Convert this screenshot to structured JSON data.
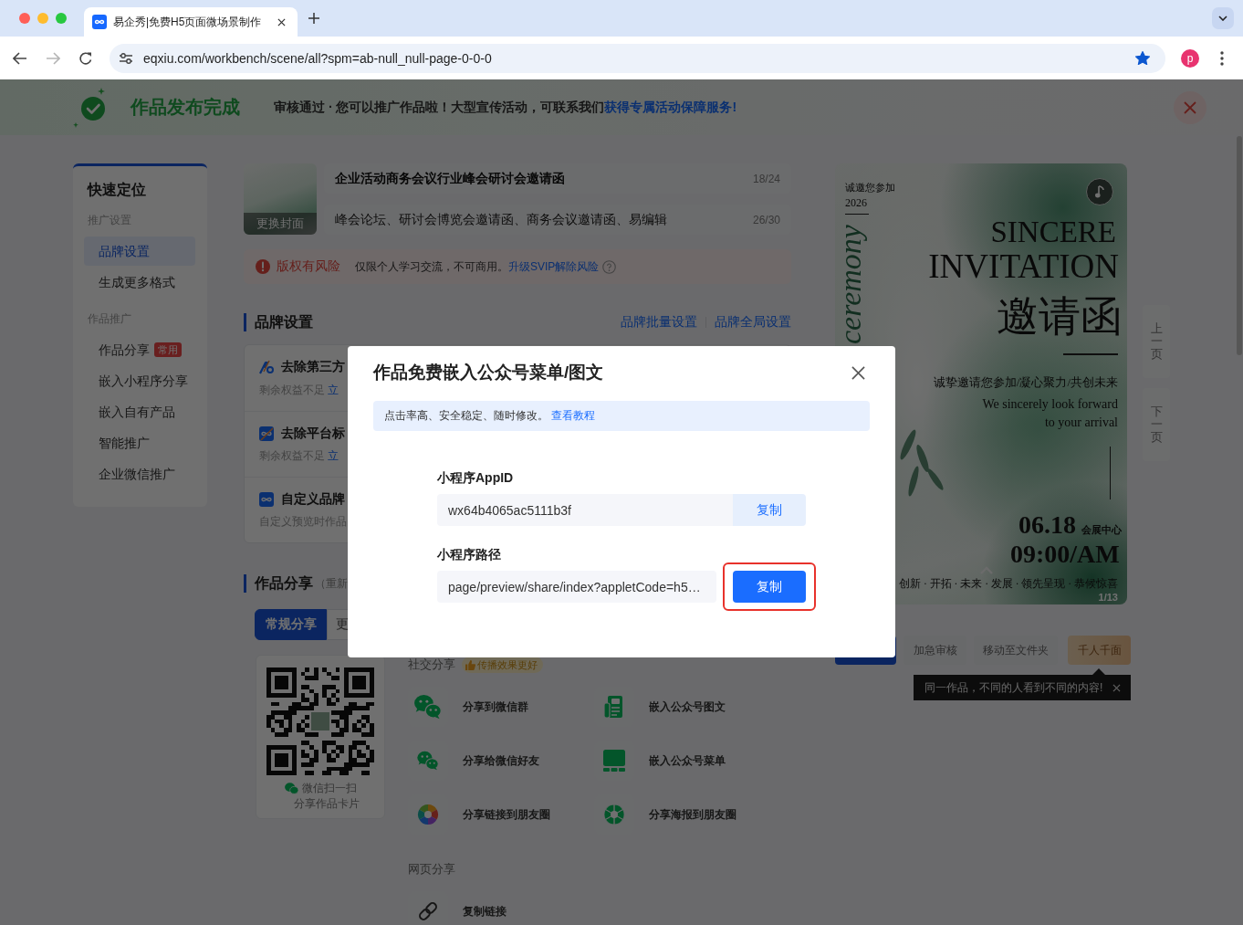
{
  "browser": {
    "tab_title": "易企秀|免费H5页面微场景制作",
    "url": "eqxiu.com/workbench/scene/all?spm=ab-null_null-page-0-0-0",
    "bookmarked": true,
    "profile_initial": "p"
  },
  "banner": {
    "title": "作品发布完成",
    "message": "审核通过 · 您可以推广作品啦！大型宣传活动，可联系我们",
    "link": "获得专属活动保障服务!"
  },
  "sidebar": {
    "title": "快速定位",
    "groups": [
      {
        "label": "推广设置",
        "items": [
          {
            "label": "品牌设置",
            "selected": true
          },
          {
            "label": "生成更多格式",
            "selected": false
          }
        ]
      },
      {
        "label": "作品推广",
        "items": [
          {
            "label": "作品分享",
            "selected": false,
            "badge": "常用"
          },
          {
            "label": "嵌入小程序分享",
            "selected": false
          },
          {
            "label": "嵌入自有产品",
            "selected": false
          },
          {
            "label": "智能推广",
            "selected": false
          },
          {
            "label": "企业微信推广",
            "selected": false
          }
        ]
      }
    ]
  },
  "work": {
    "cover_button": "更换封面",
    "title": {
      "value": "企业活动商务会议行业峰会研讨会邀请函",
      "count": "18/24"
    },
    "description": {
      "value": "峰会论坛、研讨会博览会邀请函、商务会议邀请函、易编辑",
      "count": "26/30"
    },
    "copyright": {
      "label": "版权有风险",
      "message": "仅限个人学习交流，不可商用。",
      "link": "升级SVIP解除风险"
    }
  },
  "brand_settings": {
    "heading": "品牌设置",
    "links": [
      "品牌批量设置",
      "品牌全局设置"
    ],
    "items": [
      {
        "kind": "slash-logo",
        "title": "去除第三方",
        "note": "剩余权益不足",
        "link": "立"
      },
      {
        "kind": "crossed-logo",
        "title": "去除平台标",
        "note": "剩余权益不足",
        "link": "立"
      },
      {
        "kind": "logo",
        "title": "自定义品牌",
        "note": "自定义预览时作品"
      }
    ]
  },
  "share": {
    "heading": "作品分享",
    "note": "（重新",
    "tabs": [
      {
        "label": "常规分享",
        "selected": true
      },
      {
        "label": "更",
        "selected": false
      }
    ],
    "qr": {
      "caption": "微信扫一扫",
      "subcaption": "分享作品卡片"
    },
    "social": {
      "label": "社交分享",
      "badge": "传播效果更好",
      "items": [
        {
          "kind": "wechat-group",
          "label": "分享到微信群"
        },
        {
          "kind": "article",
          "label": "嵌入公众号图文"
        },
        {
          "kind": "wechat-friend",
          "label": "分享给微信好友"
        },
        {
          "kind": "menu",
          "label": "嵌入公众号菜单"
        },
        {
          "kind": "moments-link",
          "label": "分享链接到朋友圈"
        },
        {
          "kind": "moments-poster",
          "label": "分享海报到朋友圈"
        }
      ]
    },
    "web": {
      "label": "网页分享",
      "items": [
        {
          "kind": "link",
          "label": "复制链接"
        }
      ]
    }
  },
  "preview": {
    "poster": {
      "invite_line": "诚邀您参加",
      "year": "2026",
      "script_word": "ceremony",
      "title_lines": [
        "SINCERE",
        "INVITATION"
      ],
      "title_cn": "邀请函",
      "tagline": "诚挚邀请您参加/凝心聚力/共创未来",
      "english_lines": [
        "We sincerely look forward",
        "to your arrival"
      ],
      "date": "06.18",
      "venue": "会展中心",
      "time": "09:00/AM",
      "footer": "创新 · 开拓 · 未来 · 发展 · 领先呈现 · 恭候惊喜",
      "counter": "1/13"
    },
    "pager": [
      "上一页",
      "下一页"
    ],
    "actions": [
      {
        "kind": "primary"
      },
      {
        "kind": "plain",
        "label": "加急审核"
      },
      {
        "kind": "plain",
        "label": "移动至文件夹"
      },
      {
        "kind": "featured",
        "label": "千人千面"
      }
    ],
    "tooltip": "同一作品，不同的人看到不同的内容!"
  },
  "modal": {
    "title": "作品免费嵌入公众号菜单/图文",
    "notice": "点击率高、安全稳定、随时修改。",
    "notice_link": "查看教程",
    "fields": [
      {
        "kind": "attached",
        "label": "小程序AppID",
        "value": "wx64b4065ac5111b3f",
        "button": "复制",
        "highlighted": false
      },
      {
        "kind": "primary",
        "label": "小程序路径",
        "value": "page/preview/share/index?appletCode=h5…",
        "button": "复制",
        "highlighted": true
      }
    ]
  }
}
